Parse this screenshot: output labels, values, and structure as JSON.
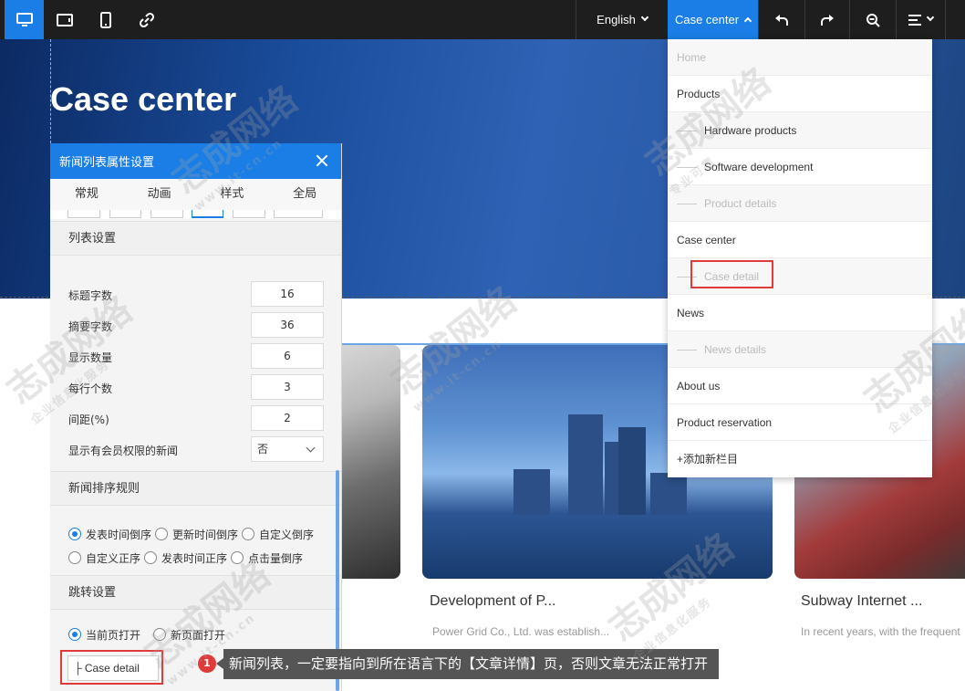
{
  "toolbar": {
    "language": "English",
    "current_page": "Case center"
  },
  "hero": {
    "title": "Case center"
  },
  "cards": [
    {
      "title": "Development of P...",
      "desc": "Power Grid Co., Ltd. was establish..."
    },
    {
      "title": "Subway Internet ...",
      "desc": "In recent years, with the frequent"
    }
  ],
  "panel": {
    "title": "新闻列表属性设置",
    "tabs": [
      "常规",
      "动画",
      "样式",
      "全局"
    ],
    "list_section": "列表设置",
    "fields": [
      {
        "label": "标题字数",
        "value": "16"
      },
      {
        "label": "摘要字数",
        "value": "36"
      },
      {
        "label": "显示数量",
        "value": "6"
      },
      {
        "label": "每行个数",
        "value": "3"
      },
      {
        "label": "间距(%)",
        "value": "2"
      }
    ],
    "member_label": "显示有会员权限的新闻",
    "member_value": "否",
    "sort_section": "新闻排序规则",
    "sort_options": [
      "发表时间倒序",
      "更新时间倒序",
      "自定义倒序",
      "自定义正序",
      "发表时间正序",
      "点击量倒序"
    ],
    "jump_section": "跳转设置",
    "jump_options": [
      "当前页打开",
      "新页面打开"
    ],
    "jump_target": "├ Case detail"
  },
  "menu": {
    "items": [
      {
        "label": "Home"
      },
      {
        "label": "Products"
      },
      {
        "label": "Hardware products"
      },
      {
        "label": "Software development"
      },
      {
        "label": "Product details"
      },
      {
        "label": "Case center"
      },
      {
        "label": "Case detail"
      },
      {
        "label": "News"
      },
      {
        "label": "News details"
      },
      {
        "label": "About us"
      },
      {
        "label": "Product reservation"
      },
      {
        "label": "+添加新栏目"
      }
    ]
  },
  "tooltip": {
    "badge": "1",
    "text": "新闻列表，一定要指向到所在语言下的【文章详情】页，否则文章无法正常打开"
  },
  "watermark": {
    "text": "志成网络",
    "sub": "www.it-cn.cn",
    "sub2": "企业信息化服务",
    "sub3": "专业可靠"
  },
  "colors": {
    "accent": "#1a7ee6",
    "toolbar": "#1e1e1e",
    "highlight": "#e03a3a"
  }
}
